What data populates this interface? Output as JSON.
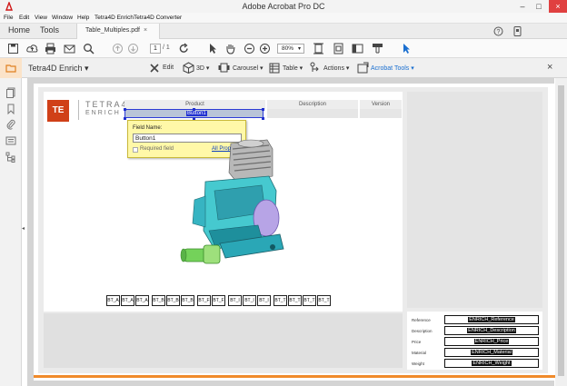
{
  "window": {
    "title": "Adobe Acrobat Pro DC",
    "minimize": "–",
    "maximize": "□",
    "close": "×"
  },
  "menu": [
    "File",
    "Edit",
    "View",
    "Window",
    "Help",
    "Tetra4D Enrich",
    "Tetra4D Converter"
  ],
  "tabs": {
    "home": "Home",
    "tools": "Tools",
    "document": "Table_Multiples.pdf",
    "doc_close": "×"
  },
  "toolbar": {
    "page_current": "1",
    "page_total": "/ 1",
    "zoom": "80%"
  },
  "enrich_bar": {
    "brand": "Tetra4D Enrich ▾",
    "edit": "Edit",
    "threed": "3D ▾",
    "carousel": "Carousel ▾",
    "table": "Table ▾",
    "actions": "Actions ▾",
    "acrobat_tools": "Acrobat Tools ▾",
    "close": "×"
  },
  "document": {
    "logo_mark": "TE",
    "logo_line1": "TETRA4D",
    "logo_line2": "ENRICH",
    "columns": [
      "Product",
      "Description",
      "Version"
    ],
    "selected_field": "Button1",
    "popup": {
      "field_name_label": "Field Name:",
      "field_name_value": "Button1",
      "required_label": "Required field",
      "all_properties": "All Properties"
    },
    "buttons": [
      "BT_A",
      "BT_A",
      "BT_A",
      "BT_B",
      "BT_B",
      "BT_B",
      "BT_F",
      "BT_F",
      "BT_I",
      "BT_I",
      "BT_I",
      "BT_T",
      "BT_T",
      "BT_T",
      "BT_T"
    ],
    "fields": [
      {
        "label": "Reference",
        "value": "ENRICH_Reference"
      },
      {
        "label": "Description",
        "value": "ENRICH_Description"
      },
      {
        "label": "Price",
        "value": "ENRICH_Price"
      },
      {
        "label": "Material",
        "value": "ENRICH_Material"
      },
      {
        "label": "Weight",
        "value": "ENRICH_Weight"
      }
    ]
  },
  "colors": {
    "accent_blue": "#1a6fd0",
    "selection": "#2030d0",
    "popup_bg": "#fff8a8",
    "brand_orange": "#d04018"
  }
}
